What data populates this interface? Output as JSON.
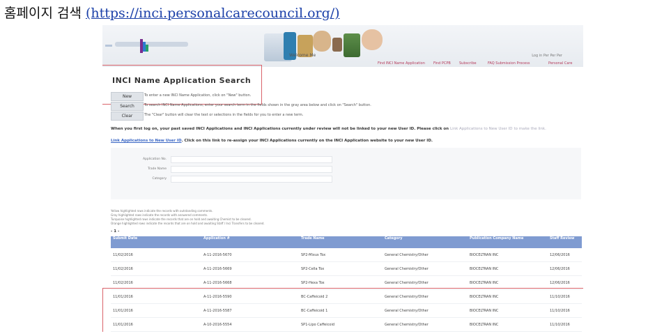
{
  "caption": {
    "label": "홈페이지 검색",
    "url": "(https://inci.personalcarecouncil.org/)"
  },
  "header": {
    "welcome": "Welcome Me",
    "login_line": "Log in Per Per Per",
    "nav": [
      "Find INCI Name Application",
      "Find PCPB",
      "Subscribe",
      "FAQ Submission Process",
      "Personal Care"
    ]
  },
  "page": {
    "title": "INCI Name Application Search",
    "buttons": [
      {
        "label": "New",
        "desc": "To enter a new INCI Name Application, click on \"New\" button."
      },
      {
        "label": "Search",
        "desc": "To search INCI Name Applications, enter your search term in the fields shown in the gray area below and click on \"Search\" button."
      },
      {
        "label": "Clear",
        "desc": "The \"Clear\" button will clear the text or selections in the fields for you to enter a new term."
      }
    ],
    "notice1": {
      "text": "When you first log on, your past saved INCI Applications and INCI Applications currently under review will not be linked to your new User ID.  Please click on",
      "link": "Link Applications to New User ID",
      "tail": "to make the link."
    },
    "notice2": {
      "link": "Link Applications to New User ID",
      "text": ". Click on this link to re-assign your INCI Applications currently on the INCI Application website to your new User ID."
    },
    "form": [
      {
        "label": "Application No."
      },
      {
        "label": "Trade Name"
      },
      {
        "label": "Category"
      }
    ],
    "legend": [
      "Yellow highlighted rows indicate the records with outstanding comments.",
      "Gray highlighted rows indicate the records with answered comments.",
      "Turquoise highlighted rows indicate the records that are on hold and awaiting Chemist to be cleared.",
      "Orange highlighted rows indicate the records that are on hold and awaiting Staff / Inci Transfers to be cleared."
    ],
    "pager": "- 1 -"
  },
  "table": {
    "headers": [
      "Submit Date",
      "Application #",
      "Trade Name",
      "Category",
      "Publication Company Name",
      "Staff Review"
    ],
    "rows": [
      [
        "11/02/2016",
        "A-11-2016-5670",
        "SP2-Mixus Tox",
        "General Chemistry/Other",
        "BIOCELTRAN INC",
        "12/06/2016"
      ],
      [
        "11/02/2016",
        "A-11-2016-5669",
        "SP2-Cella Tox",
        "General Chemistry/Other",
        "BIOCELTRAN INC",
        "12/06/2016"
      ],
      [
        "11/02/2016",
        "A-11-2016-5668",
        "SP2-Hexa Tox",
        "General Chemistry/Other",
        "BIOCELTRAN INC",
        "12/06/2016"
      ],
      [
        "11/01/2016",
        "A-11-2016-5590",
        "BC-Caffeicoid 2",
        "General Chemistry/Other",
        "BIOCELTRAN INC",
        "11/10/2016"
      ],
      [
        "11/01/2016",
        "A-11-2016-5587",
        "BC-Caffeicoid 1",
        "General Chemistry/Other",
        "BIOCELTRAN INC",
        "11/10/2016"
      ],
      [
        "11/01/2016",
        "A-10-2016-5554",
        "SP1-Lipo Caffeicoid",
        "General Chemistry/Other",
        "BIOCELTRAN INC",
        "11/10/2016"
      ]
    ]
  },
  "colors": {
    "highlight_border": "#d9636a",
    "table_header": "#7f9bd1",
    "link": "#3a66c4",
    "nav": "#b43a5a"
  }
}
